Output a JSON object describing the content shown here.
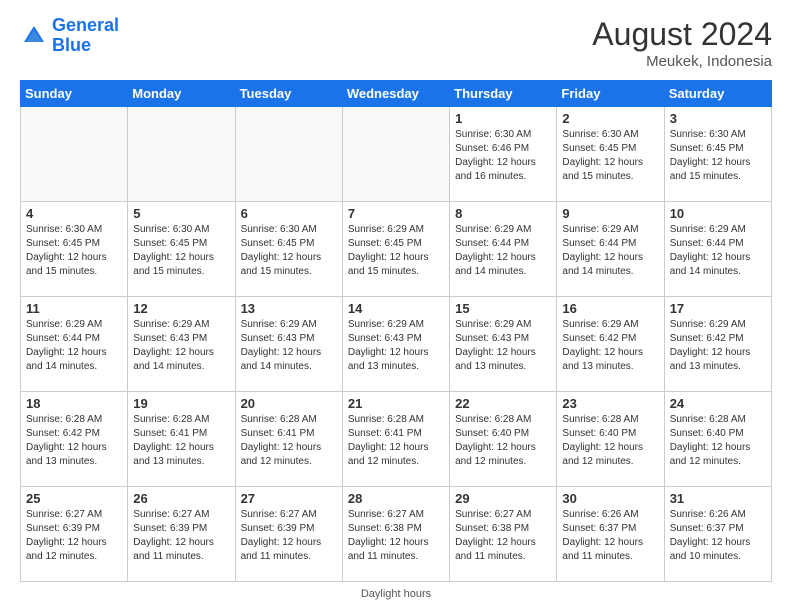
{
  "header": {
    "logo_line1": "General",
    "logo_line2": "Blue",
    "month_year": "August 2024",
    "location": "Meukek, Indonesia"
  },
  "footer": {
    "daylight_label": "Daylight hours"
  },
  "days_of_week": [
    "Sunday",
    "Monday",
    "Tuesday",
    "Wednesday",
    "Thursday",
    "Friday",
    "Saturday"
  ],
  "weeks": [
    [
      {
        "day": "",
        "text": ""
      },
      {
        "day": "",
        "text": ""
      },
      {
        "day": "",
        "text": ""
      },
      {
        "day": "",
        "text": ""
      },
      {
        "day": "1",
        "text": "Sunrise: 6:30 AM\nSunset: 6:46 PM\nDaylight: 12 hours\nand 16 minutes."
      },
      {
        "day": "2",
        "text": "Sunrise: 6:30 AM\nSunset: 6:45 PM\nDaylight: 12 hours\nand 15 minutes."
      },
      {
        "day": "3",
        "text": "Sunrise: 6:30 AM\nSunset: 6:45 PM\nDaylight: 12 hours\nand 15 minutes."
      }
    ],
    [
      {
        "day": "4",
        "text": "Sunrise: 6:30 AM\nSunset: 6:45 PM\nDaylight: 12 hours\nand 15 minutes."
      },
      {
        "day": "5",
        "text": "Sunrise: 6:30 AM\nSunset: 6:45 PM\nDaylight: 12 hours\nand 15 minutes."
      },
      {
        "day": "6",
        "text": "Sunrise: 6:30 AM\nSunset: 6:45 PM\nDaylight: 12 hours\nand 15 minutes."
      },
      {
        "day": "7",
        "text": "Sunrise: 6:29 AM\nSunset: 6:45 PM\nDaylight: 12 hours\nand 15 minutes."
      },
      {
        "day": "8",
        "text": "Sunrise: 6:29 AM\nSunset: 6:44 PM\nDaylight: 12 hours\nand 14 minutes."
      },
      {
        "day": "9",
        "text": "Sunrise: 6:29 AM\nSunset: 6:44 PM\nDaylight: 12 hours\nand 14 minutes."
      },
      {
        "day": "10",
        "text": "Sunrise: 6:29 AM\nSunset: 6:44 PM\nDaylight: 12 hours\nand 14 minutes."
      }
    ],
    [
      {
        "day": "11",
        "text": "Sunrise: 6:29 AM\nSunset: 6:44 PM\nDaylight: 12 hours\nand 14 minutes."
      },
      {
        "day": "12",
        "text": "Sunrise: 6:29 AM\nSunset: 6:43 PM\nDaylight: 12 hours\nand 14 minutes."
      },
      {
        "day": "13",
        "text": "Sunrise: 6:29 AM\nSunset: 6:43 PM\nDaylight: 12 hours\nand 14 minutes."
      },
      {
        "day": "14",
        "text": "Sunrise: 6:29 AM\nSunset: 6:43 PM\nDaylight: 12 hours\nand 13 minutes."
      },
      {
        "day": "15",
        "text": "Sunrise: 6:29 AM\nSunset: 6:43 PM\nDaylight: 12 hours\nand 13 minutes."
      },
      {
        "day": "16",
        "text": "Sunrise: 6:29 AM\nSunset: 6:42 PM\nDaylight: 12 hours\nand 13 minutes."
      },
      {
        "day": "17",
        "text": "Sunrise: 6:29 AM\nSunset: 6:42 PM\nDaylight: 12 hours\nand 13 minutes."
      }
    ],
    [
      {
        "day": "18",
        "text": "Sunrise: 6:28 AM\nSunset: 6:42 PM\nDaylight: 12 hours\nand 13 minutes."
      },
      {
        "day": "19",
        "text": "Sunrise: 6:28 AM\nSunset: 6:41 PM\nDaylight: 12 hours\nand 13 minutes."
      },
      {
        "day": "20",
        "text": "Sunrise: 6:28 AM\nSunset: 6:41 PM\nDaylight: 12 hours\nand 12 minutes."
      },
      {
        "day": "21",
        "text": "Sunrise: 6:28 AM\nSunset: 6:41 PM\nDaylight: 12 hours\nand 12 minutes."
      },
      {
        "day": "22",
        "text": "Sunrise: 6:28 AM\nSunset: 6:40 PM\nDaylight: 12 hours\nand 12 minutes."
      },
      {
        "day": "23",
        "text": "Sunrise: 6:28 AM\nSunset: 6:40 PM\nDaylight: 12 hours\nand 12 minutes."
      },
      {
        "day": "24",
        "text": "Sunrise: 6:28 AM\nSunset: 6:40 PM\nDaylight: 12 hours\nand 12 minutes."
      }
    ],
    [
      {
        "day": "25",
        "text": "Sunrise: 6:27 AM\nSunset: 6:39 PM\nDaylight: 12 hours\nand 12 minutes."
      },
      {
        "day": "26",
        "text": "Sunrise: 6:27 AM\nSunset: 6:39 PM\nDaylight: 12 hours\nand 11 minutes."
      },
      {
        "day": "27",
        "text": "Sunrise: 6:27 AM\nSunset: 6:39 PM\nDaylight: 12 hours\nand 11 minutes."
      },
      {
        "day": "28",
        "text": "Sunrise: 6:27 AM\nSunset: 6:38 PM\nDaylight: 12 hours\nand 11 minutes."
      },
      {
        "day": "29",
        "text": "Sunrise: 6:27 AM\nSunset: 6:38 PM\nDaylight: 12 hours\nand 11 minutes."
      },
      {
        "day": "30",
        "text": "Sunrise: 6:26 AM\nSunset: 6:37 PM\nDaylight: 12 hours\nand 11 minutes."
      },
      {
        "day": "31",
        "text": "Sunrise: 6:26 AM\nSunset: 6:37 PM\nDaylight: 12 hours\nand 10 minutes."
      }
    ]
  ]
}
